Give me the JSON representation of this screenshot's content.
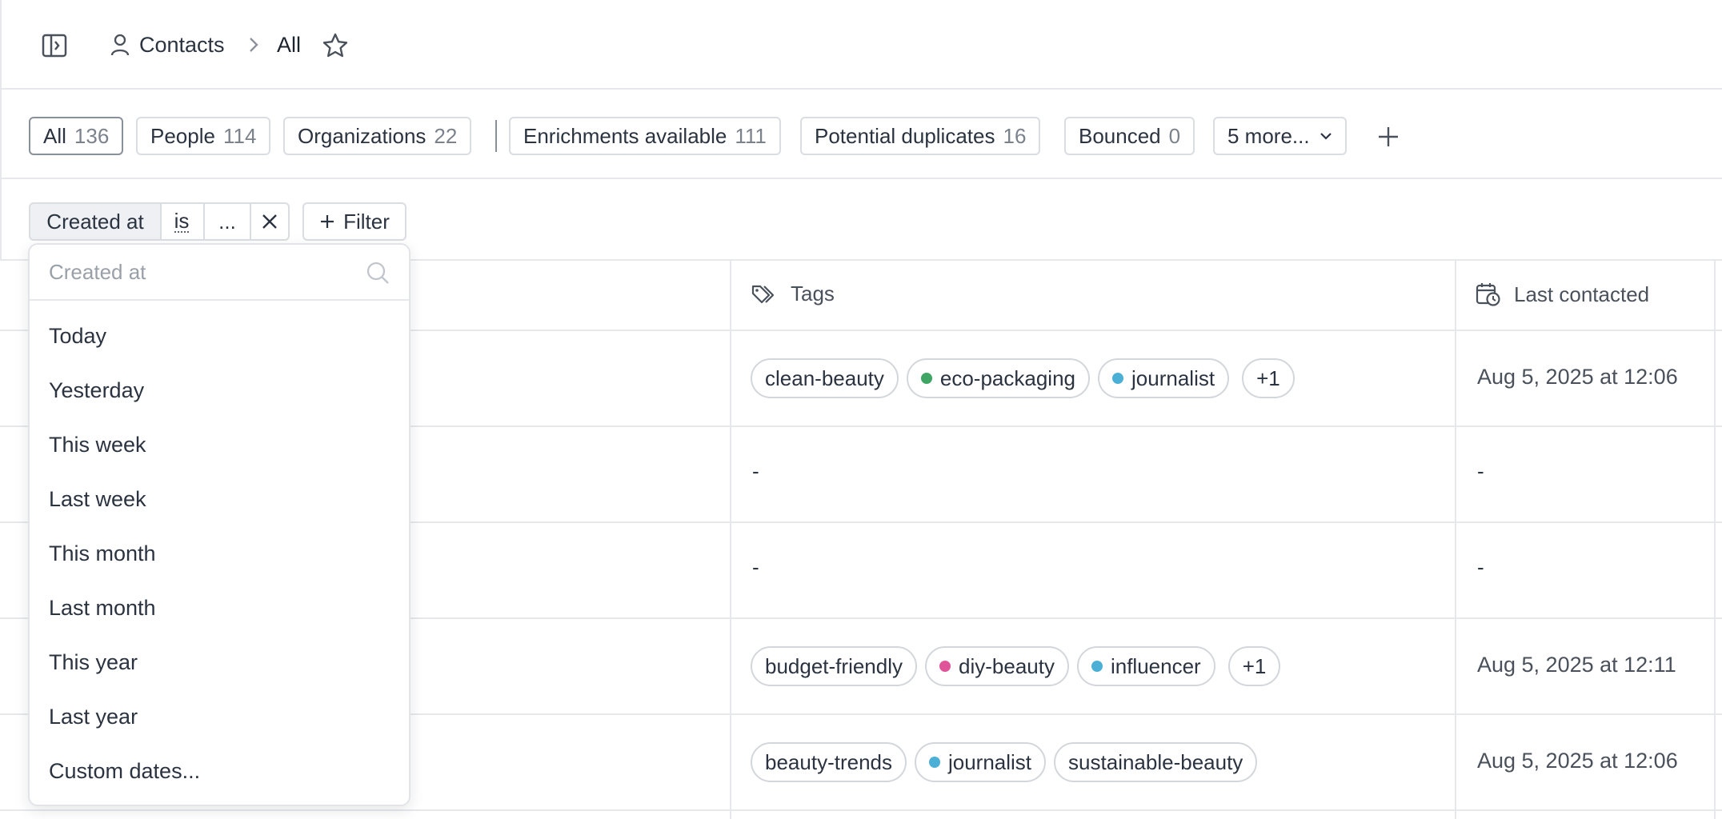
{
  "breadcrumb": {
    "section": "Contacts",
    "view": "All"
  },
  "views": [
    {
      "label": "All",
      "count": "136"
    },
    {
      "label": "People",
      "count": "114"
    },
    {
      "label": "Organizations",
      "count": "22"
    },
    {
      "label": "Enrichments available",
      "count": "111"
    },
    {
      "label": "Potential duplicates",
      "count": "16"
    },
    {
      "label": "Bounced",
      "count": "0"
    }
  ],
  "more_views_label": "5 more...",
  "filter": {
    "field": "Created at",
    "operator": "is",
    "value": "...",
    "add_label": "Filter"
  },
  "table": {
    "columns": {
      "tags": "Tags",
      "last_contacted": "Last contacted"
    },
    "rows": [
      {
        "tags": [
          {
            "label": "clean-beauty",
            "dot": ""
          },
          {
            "label": "eco-packaging",
            "dot": "#3fa564"
          },
          {
            "label": "journalist",
            "dot": "#4bafd6"
          }
        ],
        "more": "+1",
        "last_contacted": "Aug 5, 2025 at 12:06"
      },
      {
        "tags_empty": "-",
        "last_contacted": "-"
      },
      {
        "tags_empty": "-",
        "last_contacted": "-"
      },
      {
        "tags": [
          {
            "label": "budget-friendly",
            "dot": ""
          },
          {
            "label": "diy-beauty",
            "dot": "#e0559a"
          },
          {
            "label": "influencer",
            "dot": "#4bafd6"
          }
        ],
        "more": "+1",
        "last_contacted": "Aug 5, 2025 at 12:11"
      },
      {
        "tags": [
          {
            "label": "beauty-trends",
            "dot": ""
          },
          {
            "label": "journalist",
            "dot": "#4bafd6"
          },
          {
            "label": "sustainable-beauty",
            "dot": ""
          }
        ],
        "last_contacted": "Aug 5, 2025 at 12:06"
      }
    ]
  },
  "dropdown": {
    "search_placeholder": "Created at",
    "options": [
      "Today",
      "Yesterday",
      "This week",
      "Last week",
      "This month",
      "Last month",
      "This year",
      "Last year",
      "Custom dates..."
    ]
  },
  "icons": {
    "sidebar": "sidebar-toggle-icon",
    "contacts": "person-icon",
    "separator": "chevron-right-icon",
    "favorite": "star-icon",
    "more": "chevron-down-icon",
    "add_view": "plus-icon",
    "clear_filter": "close-icon",
    "tags": "tag-icon",
    "last_contacted": "calendar-clock-icon",
    "search": "search-icon"
  }
}
